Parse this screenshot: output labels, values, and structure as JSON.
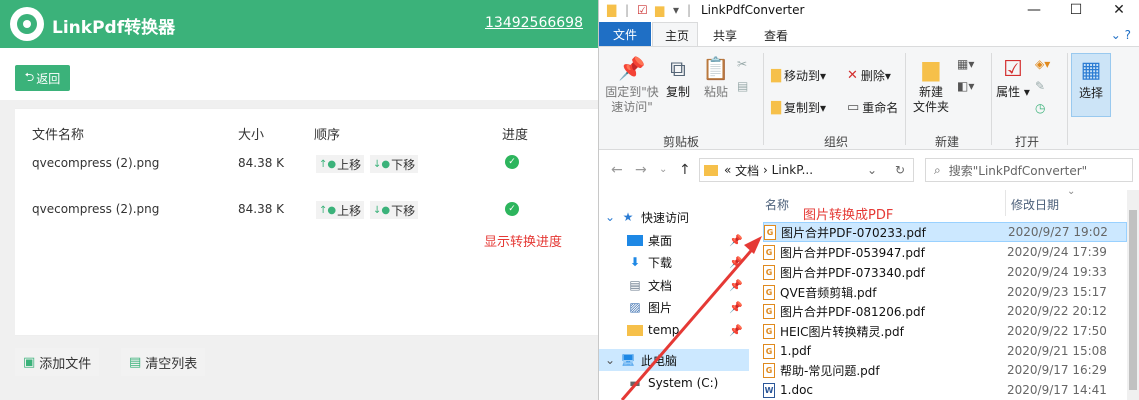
{
  "app": {
    "title": "LinkPdf转换器",
    "phone": "13492566698",
    "back_label": "返回",
    "columns": [
      "文件名称",
      "大小",
      "顺序",
      "进度"
    ],
    "files": [
      {
        "name": "qvecompress (2).png",
        "size": "84.38 K",
        "up": "上移",
        "down": "下移"
      },
      {
        "name": "qvecompress (2).png",
        "size": "84.38 K",
        "up": "上移",
        "down": "下移"
      }
    ],
    "annotation": "显示转换进度",
    "add_files": "添加文件",
    "clear_list": "清空列表",
    "accent_color": "#3bb27a"
  },
  "explorer": {
    "window_title": "LinkPdfConverter",
    "tabs": {
      "file": "文件",
      "home": "主页",
      "share": "共享",
      "view": "查看"
    },
    "ribbon": {
      "pin_line1": "固定到\"快",
      "pin_line2": "速访问\"",
      "copy": "复制",
      "paste": "粘贴",
      "move_to": "移动到",
      "delete": "删除",
      "copy_to": "复制到",
      "rename": "重命名",
      "new_folder_line1": "新建",
      "new_folder_line2": "文件夹",
      "properties": "属性",
      "select": "选择",
      "groups": {
        "clipboard": "剪贴板",
        "organize": "组织",
        "new": "新建",
        "open": "打开"
      }
    },
    "address": {
      "prefix": "«",
      "part1": "文档",
      "sep": "›",
      "part2": "LinkP..."
    },
    "search_placeholder": "搜索\"LinkPdfConverter\"",
    "nav": {
      "quick_access": "快速访问",
      "desktop": "桌面",
      "downloads": "下载",
      "documents": "文档",
      "pictures": "图片",
      "temp": "temp",
      "this_pc": "此电脑",
      "system_c": "System (C:)"
    },
    "columns": {
      "name": "名称",
      "modified": "修改日期"
    },
    "annotation": "图片转换成PDF",
    "files": [
      {
        "name": "图片合并PDF-070233.pdf",
        "date": "2020/9/27 19:02",
        "type": "pdf"
      },
      {
        "name": "图片合并PDF-053947.pdf",
        "date": "2020/9/24 17:39",
        "type": "pdf"
      },
      {
        "name": "图片合并PDF-073340.pdf",
        "date": "2020/9/24 19:33",
        "type": "pdf"
      },
      {
        "name": "QVE音频剪辑.pdf",
        "date": "2020/9/23 15:17",
        "type": "pdf"
      },
      {
        "name": "图片合并PDF-081206.pdf",
        "date": "2020/9/22 20:12",
        "type": "pdf"
      },
      {
        "name": "HEIC图片转换精灵.pdf",
        "date": "2020/9/22 17:50",
        "type": "pdf"
      },
      {
        "name": "1.pdf",
        "date": "2020/9/21 15:08",
        "type": "pdf"
      },
      {
        "name": "帮助-常见问题.pdf",
        "date": "2020/9/17 16:29",
        "type": "pdf"
      },
      {
        "name": "1.doc",
        "date": "2020/9/17 14:41",
        "type": "doc"
      }
    ]
  }
}
